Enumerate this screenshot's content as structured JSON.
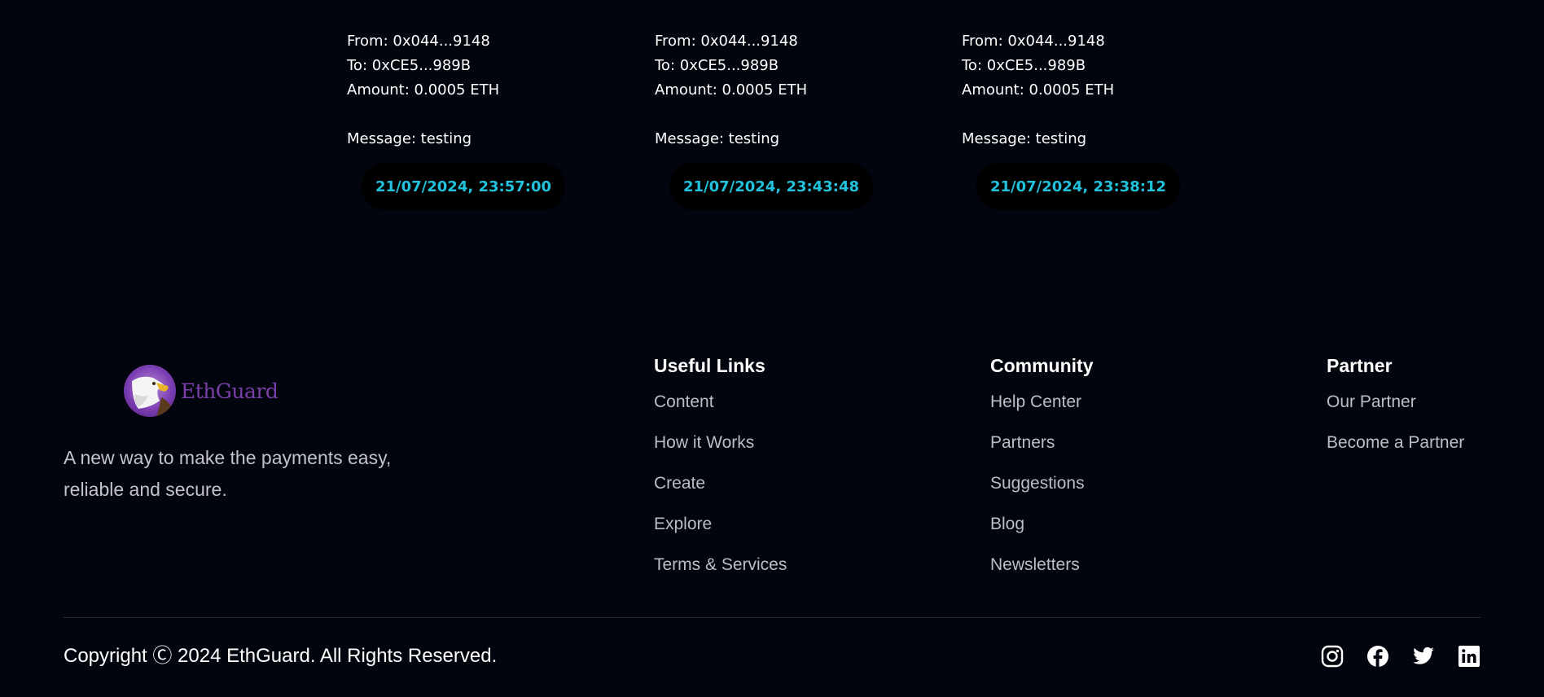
{
  "transactions": [
    {
      "from": "From: 0x044...9148",
      "to": "To: 0xCE5...989B",
      "amount": "Amount: 0.0005 ETH",
      "message": "Message: testing",
      "timestamp": "21/07/2024, 23:57:00"
    },
    {
      "from": "From: 0x044...9148",
      "to": "To: 0xCE5...989B",
      "amount": "Amount: 0.0005 ETH",
      "message": "Message: testing",
      "timestamp": "21/07/2024, 23:43:48"
    },
    {
      "from": "From: 0x044...9148",
      "to": "To: 0xCE5...989B",
      "amount": "Amount: 0.0005 ETH",
      "message": "Message: testing",
      "timestamp": "21/07/2024, 23:38:12"
    }
  ],
  "footer": {
    "brand": {
      "name": "EthGuard",
      "logo_icon": "eagle-icon"
    },
    "tagline": "A new way to make the payments easy, reliable and secure.",
    "columns": [
      {
        "title": "Useful Links",
        "links": [
          "Content",
          "How it Works",
          "Create",
          "Explore",
          "Terms & Services"
        ]
      },
      {
        "title": "Community",
        "links": [
          "Help Center",
          "Partners",
          "Suggestions",
          "Blog",
          "Newsletters"
        ]
      },
      {
        "title": "Partner",
        "links": [
          "Our Partner",
          "Become a Partner"
        ]
      }
    ],
    "copyright": "Copyright Ⓒ 2024 EthGuard. All Rights Reserved.",
    "socials": [
      "instagram-icon",
      "facebook-icon",
      "twitter-icon",
      "linkedin-icon"
    ]
  },
  "colors": {
    "background": "#02040e",
    "timestamp": "#22c1dc",
    "brand": "#7a3fa8",
    "link": "#bdbdc4"
  }
}
